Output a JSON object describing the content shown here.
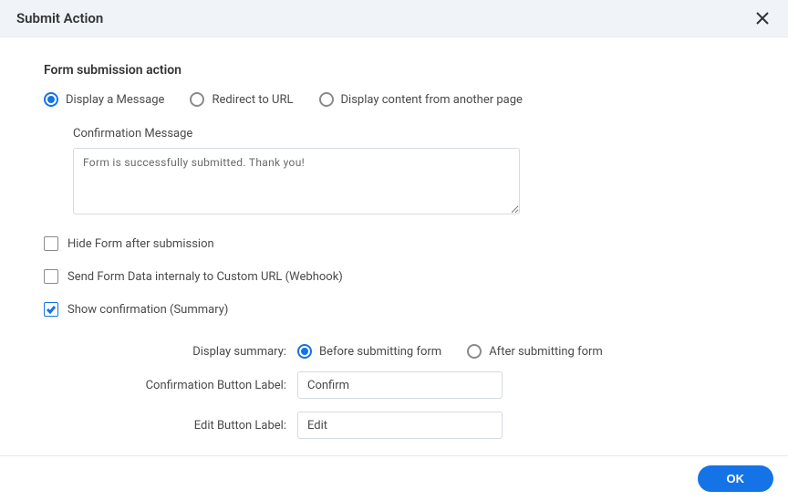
{
  "header": {
    "title": "Submit Action"
  },
  "section": {
    "title": "Form submission action"
  },
  "action_radios": {
    "display_message": "Display a Message",
    "redirect_url": "Redirect to URL",
    "display_content": "Display content from another page",
    "selected": "display_message"
  },
  "confirmation": {
    "label": "Confirmation Message",
    "value": "Form is successfully submitted. Thank you!"
  },
  "checkboxes": {
    "hide_form": {
      "label": "Hide Form after submission",
      "checked": false
    },
    "webhook": {
      "label": "Send Form Data internaly to Custom URL (Webhook)",
      "checked": false
    },
    "show_confirmation": {
      "label": "Show confirmation (Summary)",
      "checked": true
    }
  },
  "summary": {
    "display_label": "Display summary:",
    "before": "Before submitting form",
    "after": "After submitting form",
    "selected": "before",
    "confirm_btn_label_text": "Confirmation Button Label:",
    "confirm_btn_value": "Confirm",
    "edit_btn_label_text": "Edit Button Label:",
    "edit_btn_value": "Edit"
  },
  "footer": {
    "ok": "OK"
  }
}
